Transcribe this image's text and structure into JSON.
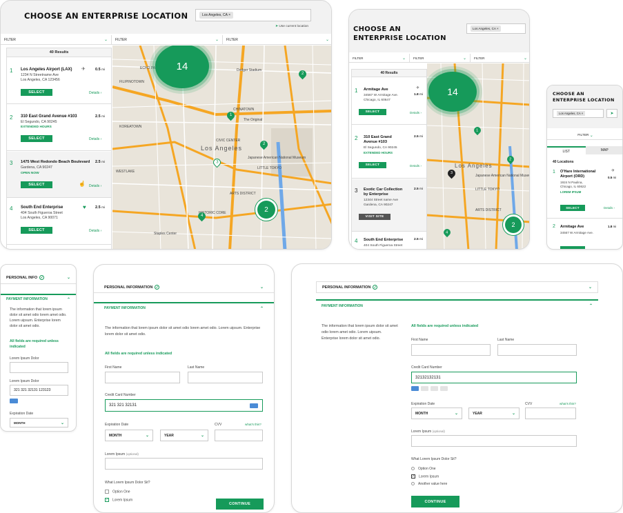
{
  "location": {
    "title": "CHOOSE AN ENTERPRISE LOCATION",
    "search_value": "Los Angeles, CA",
    "use_current": "Use current location",
    "filter_label": "FILTER",
    "results_count": "40 Results",
    "cluster_count": "14",
    "cluster_small": "2",
    "results": [
      {
        "num": "1",
        "name": "Los Angeles Airport (LAX)",
        "addr1": "1234 N Streetname Ave",
        "addr2": "Los Angeles, CA 123456",
        "dist": "0.5",
        "unit": "mi",
        "status": "",
        "button": "SELECT"
      },
      {
        "num": "2",
        "name": "310 East Grand Avenue #103",
        "addr1": "El Segundo, CA 90245",
        "addr2": "",
        "dist": "2.5",
        "unit": "mi",
        "status": "EXTENDED HOURS",
        "button": "SELECT"
      },
      {
        "num": "3",
        "name": "1475 West Redondo Beach Boulevard",
        "addr1": "Gardena, CA 90247",
        "addr2": "",
        "dist": "2.5",
        "unit": "mi",
        "status": "OPEN NOW",
        "button": "SELECT"
      },
      {
        "num": "4",
        "name": "South End Enterprise",
        "addr1": "404 South Figueroa Street",
        "addr2": "Los Angeles, CA 90071",
        "dist": "2.5",
        "unit": "mi",
        "status": "",
        "button": "SELECT"
      }
    ],
    "details": "Details",
    "map_city": "Los Angeles",
    "map_labels": [
      "ECHO PARK",
      "FILIPINOTOWN",
      "CHINATOWN",
      "LITTLE TOKYO",
      "ARTS DISTRICT",
      "KOREATOWN",
      "Dodger Stadium",
      "Japanese American National Museum",
      "The Original",
      "Staples Center",
      "WESTLAKE",
      "CIVIC CENTER",
      "HISTORIC CORE"
    ]
  },
  "tablet": {
    "title_line1": "CHOOSE AN",
    "title_line2": "ENTERPRISE LOCATION",
    "results_count": "40 Results",
    "results": [
      {
        "num": "1",
        "name": "Armitage Ave",
        "addr1": "34567 W Armitage Ave.",
        "addr2": "Chicago, IL 60647",
        "dist": "1.8",
        "unit": "mi",
        "status": "",
        "button": "SELECT"
      },
      {
        "num": "2",
        "name": "310 East Grand",
        "name2": "Avenue #103",
        "addr1": "El Segundo, CA 90245",
        "addr2": "",
        "dist": "2.5",
        "unit": "mi",
        "status": "EXTENDED HOURS",
        "button": "SELECT"
      },
      {
        "num": "3",
        "name": "Exotic Car Collection",
        "name2": "by Enterprise",
        "addr1": "12344 Street name Ave",
        "addr2": "Gardena, CA 90247",
        "dist": "2.5",
        "unit": "mi",
        "status": "",
        "button": "VISIT SITE"
      },
      {
        "num": "4",
        "name": "South End Enterprise",
        "addr1": "404 South Figueroa Street",
        "addr2": "",
        "dist": "2.5",
        "unit": "mi",
        "status": "",
        "button": ""
      }
    ]
  },
  "mobile": {
    "title_line1": "CHOOSE AN",
    "title_line2": "ENTERPRISE LOCATION",
    "search_value": "Los Angeles, CA",
    "filter_label": "FILTER",
    "tab_list": "LIST",
    "tab_map": "MAP",
    "locations_count": "40 Locations",
    "r1_name1": "O'Hare International",
    "r1_name2": "Airport (ORD)",
    "r1_addr1": "1924 N Paulina,",
    "r1_addr2": "Chicago, IL 60622",
    "r1_status": "LOREM IPSUM",
    "r1_dist": "0.5",
    "r1_unit": "mi",
    "r2_name": "Armitage Ave",
    "r2_addr": "34567 W Armitage Ave.",
    "r2_dist": "1.8",
    "r2_unit": "mi",
    "select": "SELECT",
    "details": "Details"
  },
  "form_small": {
    "personal": "PERSONAL INFO",
    "payment": "PAYMENT INFORMATION",
    "info_text": "The information that lorem ipsum dolor sit amet odio lorem amet odio. Lorem uipsum. Enterprise lorem dolor sit amet odio.",
    "required": "All fields are required unless indicated",
    "field1_label": "Lorem Ipsum Dolor",
    "field2_label": "Lorem Ipsum Dolor",
    "card_value": "321  321  32131 123123",
    "exp_label": "Expiration Date",
    "month": "MONTH"
  },
  "form_med": {
    "personal": "PERSONAL INFORMATION",
    "payment": "PAYMENT INFORMATION",
    "info_text": "The information that lorem ipsum dolor sit amet odio lorem amet odio. Lorem uipsum. Enterprise lorem dolor sit amet odio.",
    "required": "All fields are required unless indicated",
    "first_name": "First Name",
    "last_name": "Last Name",
    "cc_label": "Credit Card Number",
    "cc_value": "321  321  32131",
    "exp_label": "Expiration Date",
    "cvv": "CVV",
    "whats_this": "what's this?",
    "month": "MONTH",
    "year": "YEAR",
    "optional_label": "Lorem Ipsum",
    "optional": "(optional)",
    "question": "What Lorem Ipsum Dolor Sit?",
    "opt1": "Option One",
    "opt2": "Lorem Ipsum",
    "continue": "CONTINUE"
  },
  "form_large": {
    "personal": "PERSONAL INFORMATION",
    "payment": "PAYMENT INFORMATION",
    "info_text": "The information that lorem ipsum dolor sit amet odio lorem amet odio. Lorem uipsum. Enterprise lorem dolor sit amet odio.",
    "required": "All fields are required unless indicated",
    "first_name": "First Name",
    "last_name": "Last Name",
    "cc_label": "Credit Card Number",
    "cc_value": "32132132131",
    "exp_label": "Expiration Date",
    "cvv": "CVV",
    "whats_this": "what's this?",
    "month": "MONTH",
    "year": "YEAR",
    "optional_label": "Lorem Ipsum",
    "optional": "(optional)",
    "question": "What Lorem Ipsum Dolor Sit?",
    "opt1": "Option One",
    "opt2": "Lorem Ipsum",
    "opt3": "Another value here",
    "continue": "CONTINUE"
  },
  "colors": {
    "brand": "#169a5a",
    "map_bg": "#e7e2d8",
    "road": "#f5a623"
  }
}
